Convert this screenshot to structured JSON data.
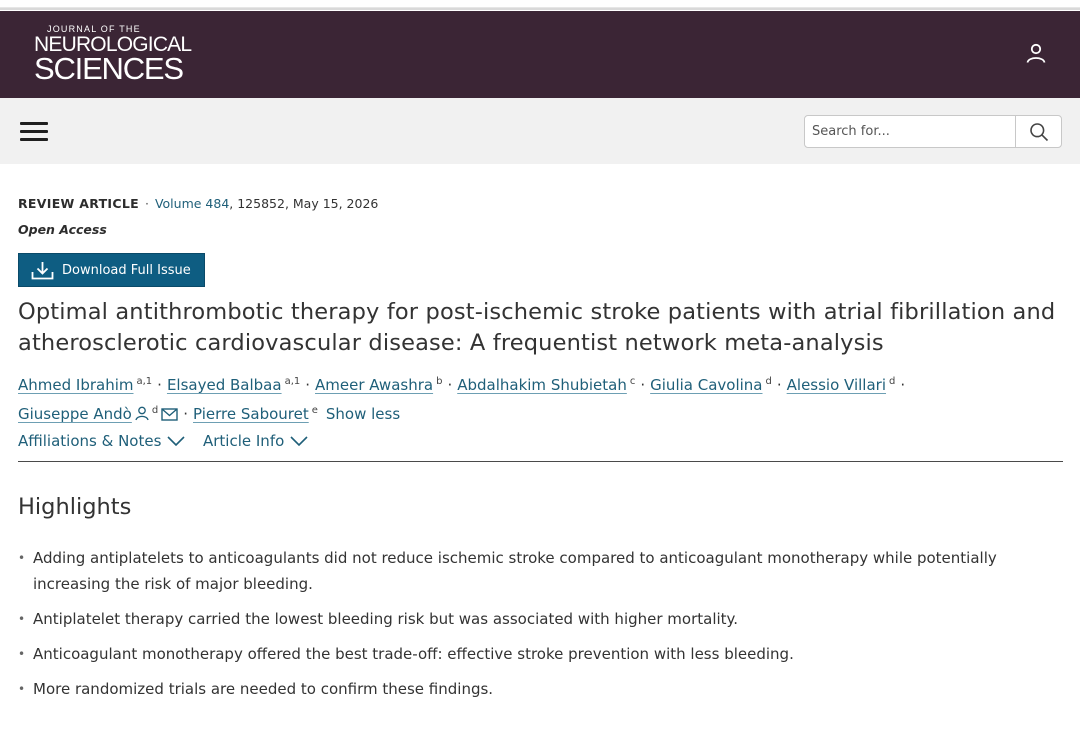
{
  "header": {
    "journal_line1": "JOURNAL OF THE",
    "journal_line2": "NEUROLOGICAL",
    "journal_line3": "SCIENCES"
  },
  "nav": {
    "search_placeholder": "Search for..."
  },
  "article": {
    "type": "REVIEW ARTICLE",
    "volume": "Volume 484",
    "citation": ", 125852, May 15, 2026",
    "access": "Open Access",
    "download_label": "Download Full Issue",
    "title": "Optimal antithrombotic therapy for post-ischemic stroke patients with atrial fibrillation and atherosclerotic cardiovascular disease: A frequentist network meta-analysis",
    "authors": [
      {
        "name": "Ahmed Ibrahim",
        "sup": "a,1"
      },
      {
        "name": "Elsayed Balbaa",
        "sup": "a,1"
      },
      {
        "name": "Ameer Awashra",
        "sup": "b"
      },
      {
        "name": "Abdalhakim Shubietah",
        "sup": "c"
      },
      {
        "name": "Giulia Cavolina",
        "sup": "d"
      },
      {
        "name": "Alessio Villari",
        "sup": "d"
      },
      {
        "name": "Giuseppe Andò",
        "sup": "d"
      },
      {
        "name": "Pierre Sabouret",
        "sup": "e"
      }
    ],
    "show_less": "Show less",
    "tabs": [
      "Affiliations & Notes",
      "Article Info"
    ]
  },
  "highlights": {
    "heading": "Highlights",
    "items": [
      "Adding antiplatelets to anticoagulants did not reduce ischemic stroke compared to anticoagulant monotherapy while potentially increasing the risk of major bleeding.",
      "Antiplatelet therapy carried the lowest bleeding risk but was associated with higher mortality.",
      "Anticoagulant monotherapy offered the best trade-off: effective stroke prevention with less bleeding.",
      "More randomized trials are needed to confirm these findings."
    ]
  },
  "colors": {
    "brand_bar": "#3b2535",
    "link": "#1f5f79",
    "download_button": "#0e5d82"
  },
  "icons": [
    "user-icon",
    "menu-icon",
    "search-icon",
    "download-icon",
    "person-icon",
    "mail-icon",
    "chevron-down-icon"
  ]
}
